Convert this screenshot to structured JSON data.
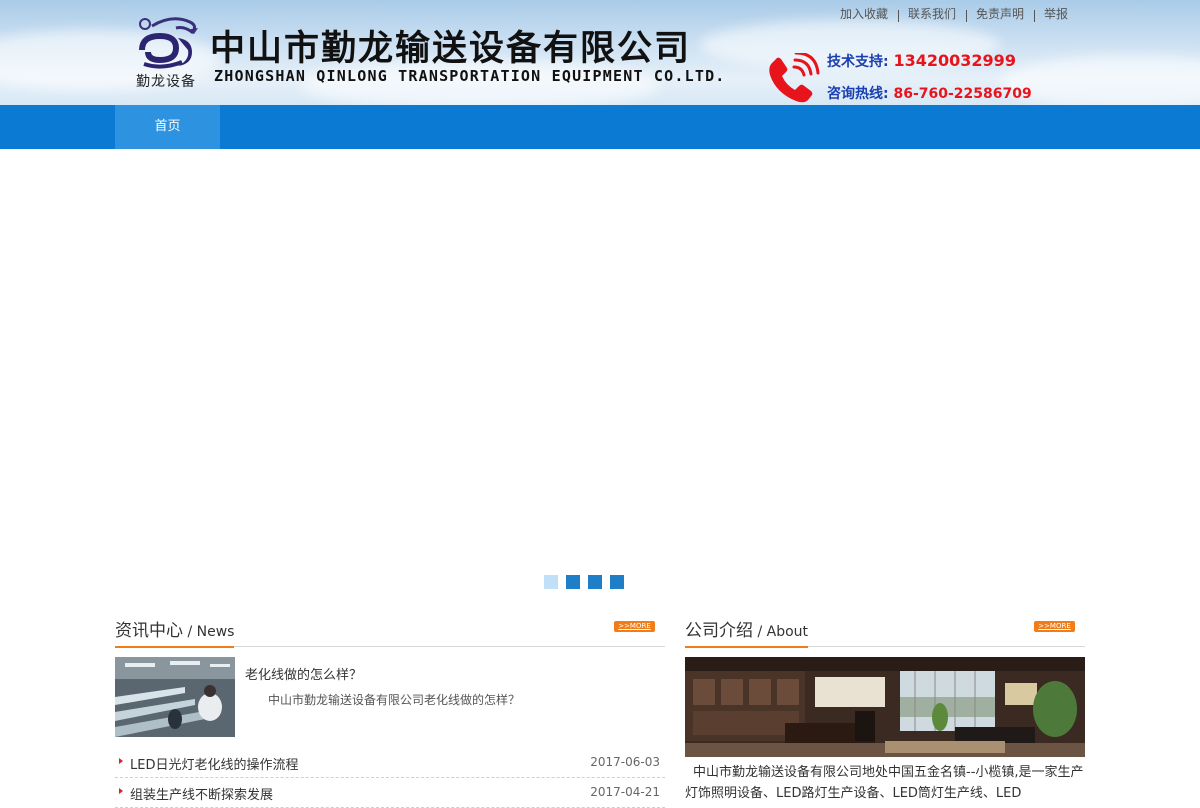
{
  "header": {
    "logo_caption": "勤龙设备",
    "company_cn": "中山市勤龙输送设备有限公司",
    "company_en": "ZHONGSHAN QINLONG TRANSPORTATION EQUIPMENT CO.LTD.",
    "top_links": [
      "加入收藏",
      "联系我们",
      "免责声明",
      "举报"
    ],
    "tech_support_label": "技术支持:",
    "tech_support_number": "13420032999",
    "hotline_label": "咨询热线:",
    "hotline_number": "86-760-22586709"
  },
  "nav": {
    "items": [
      {
        "label": "首页",
        "active": true
      }
    ]
  },
  "banner": {
    "dots": 4,
    "active_dot": 0
  },
  "news": {
    "title_cn": "资讯中心",
    "title_en": " / News",
    "more_label": ">>MORE",
    "feature": {
      "title": "老化线做的怎么样？",
      "desc": "中山市勤龙输送设备有限公司老化线做的怎样？"
    },
    "items": [
      {
        "title": "LED日光灯老化线的操作流程",
        "date": "2017-06-03"
      },
      {
        "title": "组装生产线不断探索发展",
        "date": "2017-04-21"
      }
    ]
  },
  "about": {
    "title_cn": "公司介绍",
    "title_en": " / About",
    "more_label": ">>MORE",
    "text": "中山市勤龙输送设备有限公司地处中国五金名镇--小榄镇,是一家生产灯饰照明设备、LED路灯生产设备、LED筒灯生产线、LED"
  },
  "colors": {
    "nav_bg": "#0b7ad2",
    "nav_active": "#2d92e0",
    "accent_orange": "#f07d1a",
    "hotline_label": "#1a3fb0",
    "hotline_number": "#e8141b"
  }
}
